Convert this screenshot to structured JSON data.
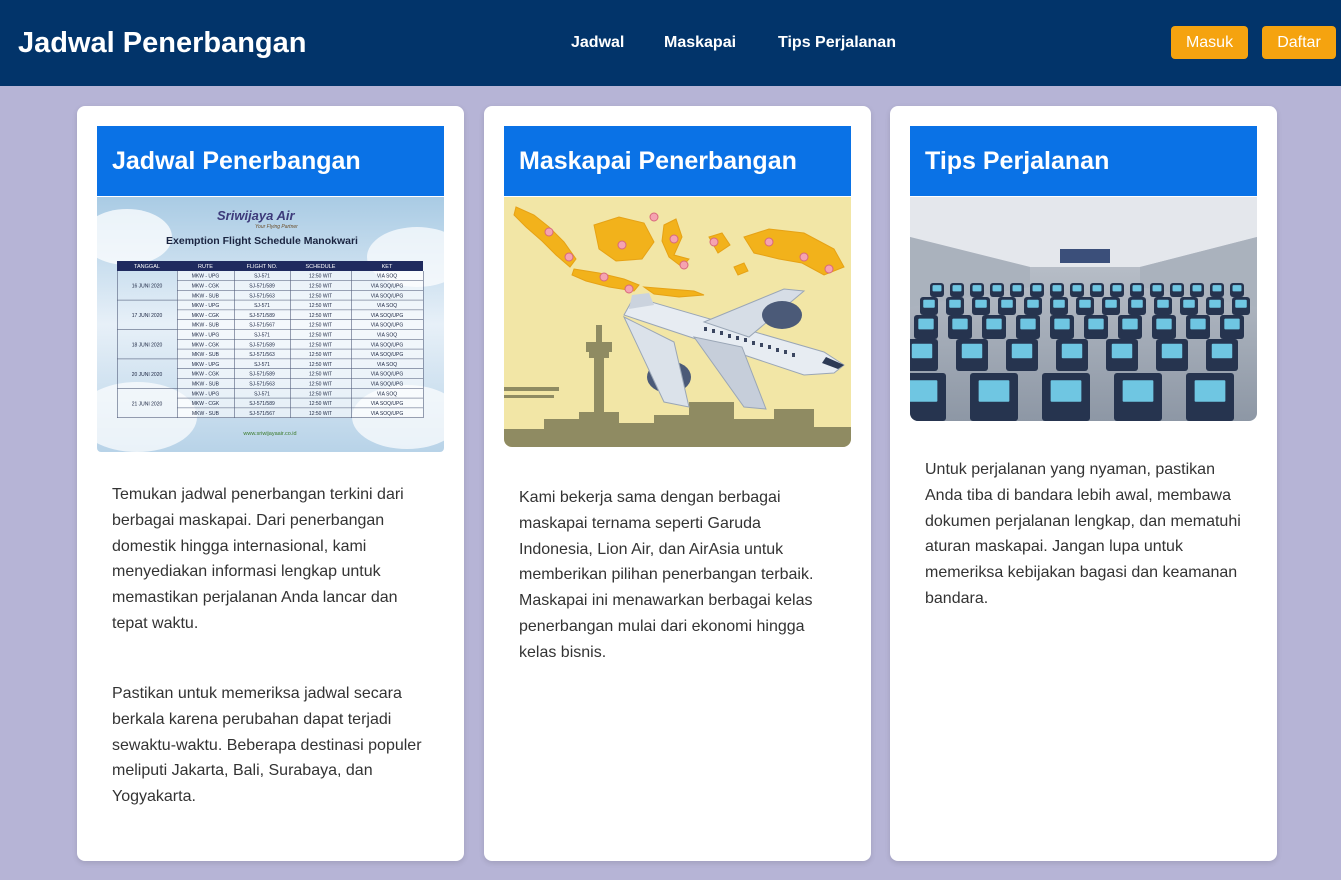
{
  "header": {
    "title": "Jadwal Penerbangan",
    "nav": [
      "Jadwal",
      "Maskapai",
      "Tips Perjalanan"
    ],
    "login_label": "Masuk",
    "register_label": "Daftar"
  },
  "colors": {
    "header_bg": "#02346a",
    "page_bg": "#b6b4d6",
    "card_header_bg": "#0a72e6",
    "button_bg": "#f5a30f"
  },
  "cards": [
    {
      "title": "Jadwal Penerbangan",
      "image": {
        "brand": "Sriwijaya Air",
        "tagline": "Your Flying Partner",
        "heading": "Exemption Flight Schedule Manokwari",
        "columns": [
          "TANGGAL",
          "RUTE",
          "FLIGHT NO.",
          "SCHEDULE",
          "KET"
        ],
        "dates": [
          "16 JUNI 2020",
          "17 JUNI 2020",
          "18 JUNI 2020",
          "20 JUNI 2020",
          "21 JUNI 2020"
        ],
        "rows": [
          [
            "MKW - UPG",
            "SJ-571",
            "12:50 WIT",
            "VIA SOQ"
          ],
          [
            "MKW - CGK",
            "SJ-571/589",
            "12:50 WIT",
            "VIA SOQ/UPG"
          ],
          [
            "MKW - SUB",
            "SJ-571/563",
            "12:50 WIT",
            "VIA SOQ/UPG"
          ],
          [
            "MKW - UPG",
            "SJ-571",
            "12:50 WIT",
            "VIA SOQ"
          ],
          [
            "MKW - CGK",
            "SJ-571/589",
            "12:50 WIT",
            "VIA SOQ/UPG"
          ],
          [
            "MKW - SUB",
            "SJ-571/567",
            "12:50 WIT",
            "VIA SOQ/UPG"
          ],
          [
            "MKW - UPG",
            "SJ-571",
            "12:50 WIT",
            "VIA SOQ"
          ],
          [
            "MKW - CGK",
            "SJ-571/589",
            "12:50 WIT",
            "VIA SOQ/UPG"
          ],
          [
            "MKW - SUB",
            "SJ-571/563",
            "12:50 WIT",
            "VIA SOQ/UPG"
          ],
          [
            "MKW - UPG",
            "SJ-571",
            "12:50 WIT",
            "VIA SOQ"
          ],
          [
            "MKW - CGK",
            "SJ-571/589",
            "12:50 WIT",
            "VIA SOQ/UPG"
          ],
          [
            "MKW - SUB",
            "SJ-571/563",
            "12:50 WIT",
            "VIA SOQ/UPG"
          ],
          [
            "MKW - UPG",
            "SJ-571",
            "12:50 WIT",
            "VIA SOQ"
          ],
          [
            "MKW - CGK",
            "SJ-571/589",
            "12:50 WIT",
            "VIA SOQ/UPG"
          ],
          [
            "MKW - SUB",
            "SJ-571/567",
            "12:50 WIT",
            "VIA SOQ/UPG"
          ]
        ],
        "footer": "www.sriwijayaair.co.id"
      },
      "paragraphs": [
        "Temukan jadwal penerbangan terkini dari berbagai maskapai. Dari penerbangan domestik hingga internasional, kami menyediakan informasi lengkap untuk memastikan perjalanan Anda lancar dan tepat waktu.",
        "Pastikan untuk memeriksa jadwal secara berkala karena perubahan dapat terjadi sewaktu-waktu. Beberapa destinasi populer meliputi Jakarta, Bali, Surabaya, dan Yogyakarta."
      ]
    },
    {
      "title": "Maskapai Penerbangan",
      "image": {},
      "paragraphs": [
        "Kami bekerja sama dengan berbagai maskapai ternama seperti Garuda Indonesia, Lion Air, dan AirAsia untuk memberikan pilihan penerbangan terbaik. Maskapai ini menawarkan berbagai kelas penerbangan mulai dari ekonomi hingga kelas bisnis."
      ]
    },
    {
      "title": "Tips Perjalanan",
      "image": {},
      "paragraphs": [
        "Untuk perjalanan yang nyaman, pastikan Anda tiba di bandara lebih awal, membawa dokumen perjalanan lengkap, dan mematuhi aturan maskapai. Jangan lupa untuk memeriksa kebijakan bagasi dan keamanan bandara."
      ]
    }
  ]
}
